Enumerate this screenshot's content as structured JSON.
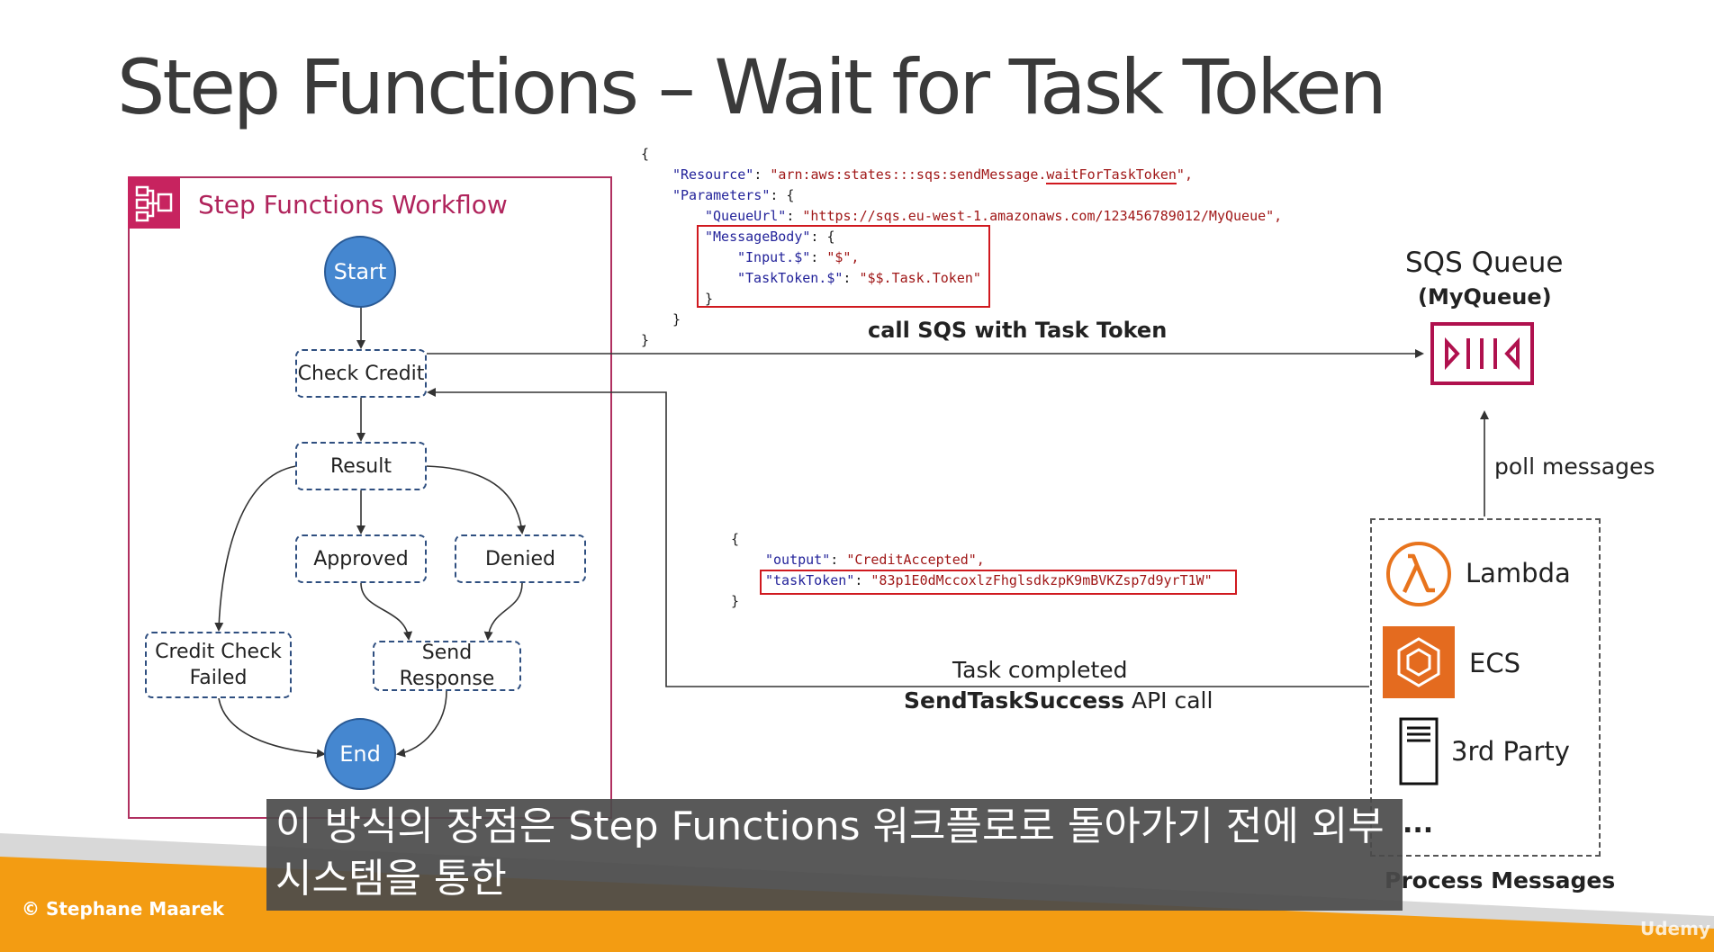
{
  "slide": {
    "title": "Step Functions – Wait for Task Token",
    "copyright": "© Stephane Maarek",
    "watermark": "Udemy"
  },
  "workflow": {
    "label": "Step Functions Workflow",
    "icon": "step-functions-icon",
    "nodes": {
      "start": "Start",
      "check_credit": "Check Credit",
      "result": "Result",
      "approved": "Approved",
      "denied": "Denied",
      "credit_check_failed_line1": "Credit Check",
      "credit_check_failed_line2": "Failed",
      "send_response": "Send Response",
      "end": "End"
    }
  },
  "request_code": {
    "open": "{",
    "resource_key": "\"Resource\"",
    "resource_value_prefix": "\"arn:aws:states:::sqs:sendMessage.",
    "resource_value_highlight": "waitForTaskToken",
    "resource_value_suffix": "\",",
    "parameters_key": "\"Parameters\"",
    "parameters_open": ": {",
    "queueurl_key": "\"QueueUrl\"",
    "queueurl_value": "\"https://sqs.eu-west-1.amazonaws.com/123456789012/MyQueue\",",
    "messagebody_key": "\"MessageBody\"",
    "messagebody_open": ": {",
    "input_key": "\"Input.$\"",
    "input_value": "\"$\",",
    "tasktoken_key": "\"TaskToken.$\"",
    "tasktoken_value": "\"$$.Task.Token\"",
    "close_inner": "}",
    "close_params": "}",
    "close": "}"
  },
  "response_code": {
    "open": "{",
    "output_key": "\"output\"",
    "output_value": "\"CreditAccepted\",",
    "tasktoken_key": "\"taskToken\"",
    "tasktoken_value": "\"83p1E0dMccoxlzFhglsdkzpK9mBVKZsp7d9yrT1W\"",
    "close": "}"
  },
  "arrows": {
    "call_sqs": "call SQS with Task Token",
    "task_completed": "Task completed",
    "send_task_success_bold": "SendTaskSuccess",
    "send_task_success_rest": " API call",
    "poll_messages": "poll messages"
  },
  "sqs": {
    "title": "SQS Queue",
    "subtitle": "(MyQueue)",
    "icon": "sqs-queue-icon"
  },
  "process": {
    "lambda": "Lambda",
    "ecs": "ECS",
    "third_party": "3rd Party",
    "ellipsis": "...",
    "label": "Process Messages",
    "lambda_icon": "lambda-icon",
    "ecs_icon": "ecs-icon",
    "server_icon": "server-icon"
  },
  "subtitle": {
    "line1": "이 방식의 장점은 Step Functions 워크플로로 돌아가기 전에 외부",
    "line2": "시스템을 통한"
  },
  "colors": {
    "brand_pink": "#c7235f",
    "node_blue": "#4587d0",
    "orange": "#f39c12",
    "highlight_red": "#d0191f",
    "sqs_pink": "#b0114e"
  }
}
